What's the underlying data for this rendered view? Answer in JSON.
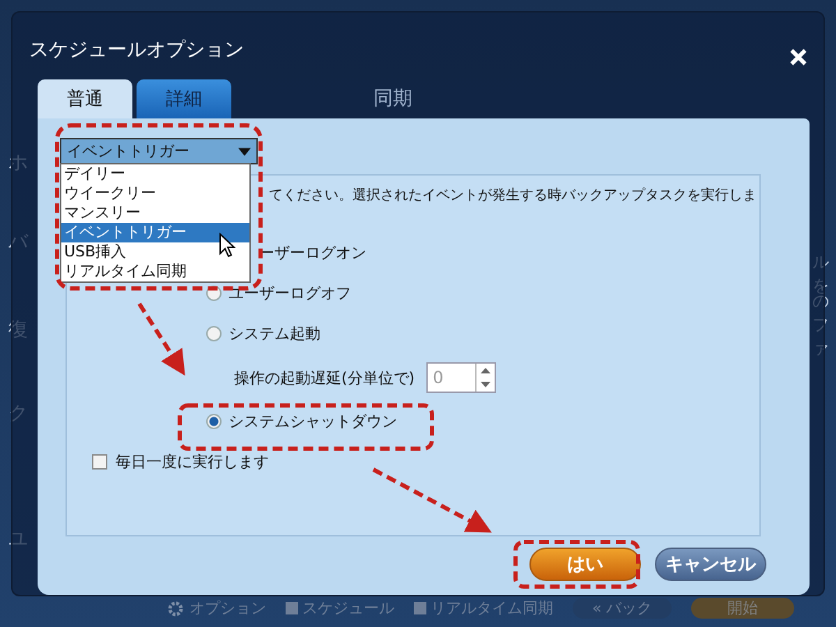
{
  "app": {
    "header": "同期",
    "sidebar": [
      {
        "label": "ホ"
      },
      {
        "label": "バ"
      },
      {
        "label": "復"
      },
      {
        "label": "ク"
      },
      {
        "label": "ユ"
      }
    ],
    "side_notes": [
      "ルを",
      "のファ"
    ],
    "bottom_bar": {
      "items": [
        "オプション",
        "スケジュール",
        "リアルタイム同期"
      ],
      "back": "« バック",
      "start": "開始"
    }
  },
  "dialog": {
    "title": "スケジュールオプション",
    "tabs": [
      {
        "label": "普通",
        "selected": true
      },
      {
        "label": "詳細",
        "selected": false
      }
    ],
    "schedule_type": {
      "value": "イベントトリガー",
      "expanded": true,
      "options": [
        {
          "label": "デイリー",
          "selected": false
        },
        {
          "label": "ウイークリー",
          "selected": false
        },
        {
          "label": "マンスリー",
          "selected": false
        },
        {
          "label": "イベントトリガー",
          "selected": true
        },
        {
          "label": "USB挿入",
          "selected": false
        },
        {
          "label": "リアルタイム同期",
          "selected": false
        }
      ]
    },
    "description": "てください。選択されたイベントが発生する時バックアップタスクを実行しま",
    "events": [
      {
        "kind": "text",
        "label": "ーザーログオン"
      },
      {
        "kind": "radio",
        "label": "ユーザーログオフ",
        "selected": false
      },
      {
        "kind": "radio",
        "label": "システム起動",
        "selected": false
      },
      {
        "kind": "delay",
        "label": "操作の起動遅延(分単位で)",
        "value": "0"
      },
      {
        "kind": "radio",
        "label": "システムシャットダウン",
        "selected": true
      }
    ],
    "daily_once": {
      "label": "毎日一度に実行します",
      "checked": false
    },
    "buttons": [
      {
        "label": "はい",
        "kind": "primary"
      },
      {
        "label": "キャンセル",
        "kind": "secondary"
      }
    ]
  }
}
